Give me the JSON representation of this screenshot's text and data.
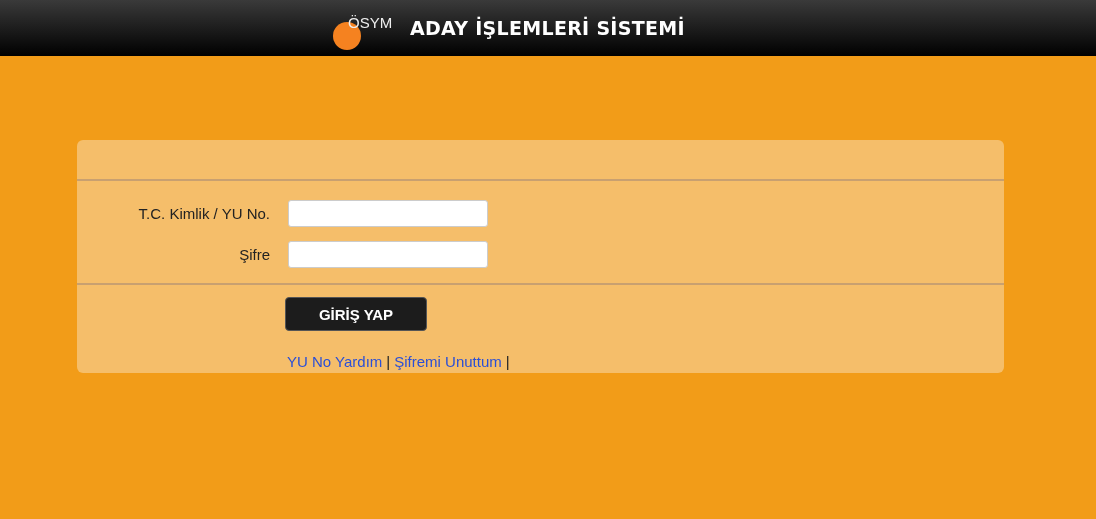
{
  "header": {
    "logo_text": "ÖSYM",
    "title": "ADAY İŞLEMLERİ SİSTEMİ"
  },
  "form": {
    "fields": [
      {
        "label": "T.C. Kimlik / YU No."
      },
      {
        "label": "Şifre"
      }
    ],
    "submit": "GİRİŞ YAP",
    "links": [
      {
        "text": "YU No Yardım",
        "separator": "|"
      },
      {
        "text": "Şifremi Unuttum",
        "separator": "|"
      }
    ]
  }
}
